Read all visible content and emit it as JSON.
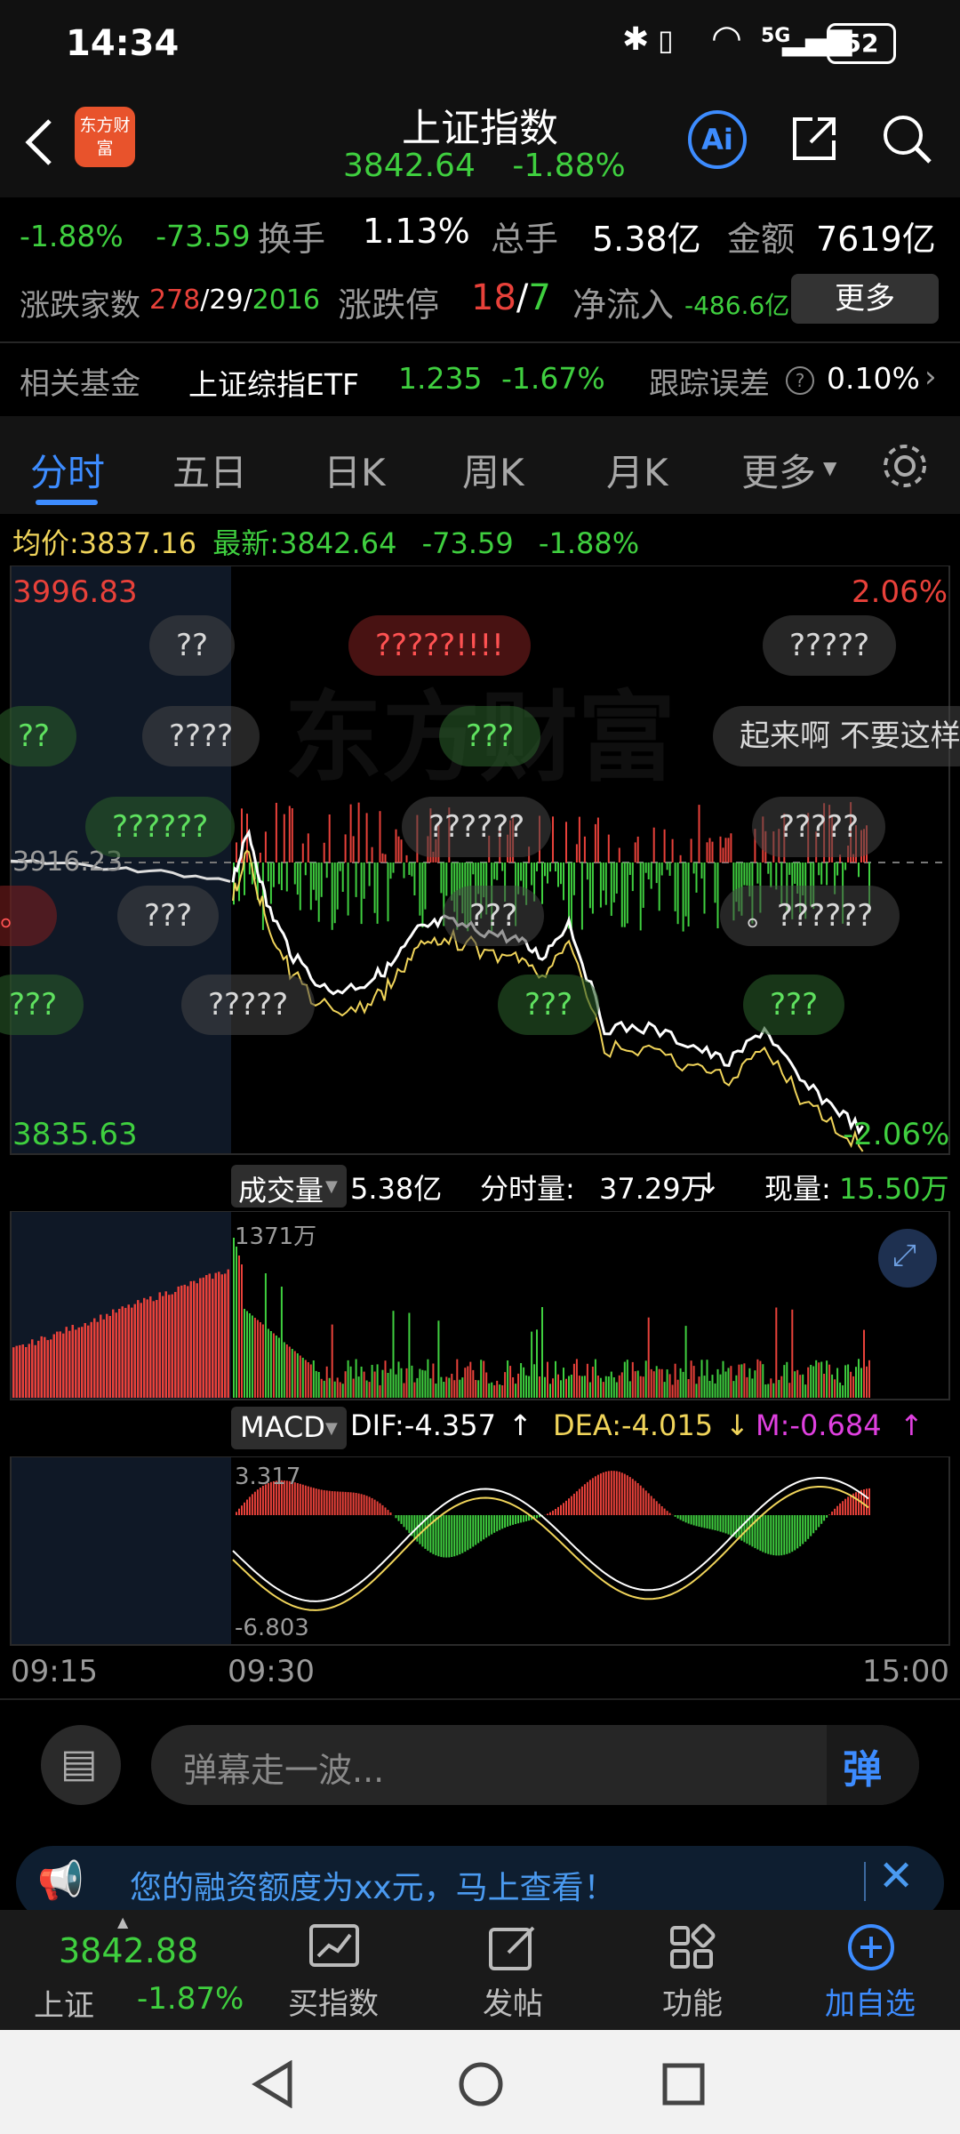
{
  "status": {
    "time": "14:34",
    "battery": "52",
    "network": "5G"
  },
  "header": {
    "title": "上证指数",
    "price": "3842.64",
    "change_pct": "-1.88%",
    "ai_label": "Ai",
    "logo_text": "东方财富"
  },
  "info_row1": {
    "change_pct": "-1.88%",
    "change": "-73.59",
    "turnover_label": "换手",
    "turnover": "1.13%",
    "volume_label": "总手",
    "volume": "5.38亿",
    "amount_label": "金额",
    "amount": "7619亿"
  },
  "info_row2": {
    "breadth_label": "涨跌家数",
    "up": "278",
    "flat": "29",
    "down": "2016",
    "limit_label": "涨跌停",
    "limit_up": "18",
    "limit_down": "7",
    "netflow_label": "净流入",
    "netflow": "-486.6亿",
    "more": "更多"
  },
  "fund_row": {
    "label": "相关基金",
    "name": "上证综指ETF",
    "price": "1.235",
    "change": "-1.67%",
    "tracking_label": "跟踪误差",
    "tracking": "0.10%"
  },
  "tabs": [
    "分时",
    "五日",
    "日K",
    "周K",
    "月K",
    "更多"
  ],
  "price_info": {
    "avg_label": "均价:",
    "avg": "3837.16",
    "last_label": "最新:",
    "last": "3842.64",
    "chg": "-73.59",
    "pct": "-1.88%"
  },
  "chart_labels": {
    "high": "3996.83",
    "high_pct": "2.06%",
    "low": "3835.63",
    "low_pct": "-2.06%",
    "prev_close": "3916.23",
    "watermark": "东方财富"
  },
  "danmaku": [
    {
      "text": "??",
      "type": "n"
    },
    {
      "text": "?????!!!!",
      "type": "r"
    },
    {
      "text": "?????",
      "type": "n"
    },
    {
      "text": "??",
      "type": "g"
    },
    {
      "text": "????",
      "type": "n"
    },
    {
      "text": "???",
      "type": "g"
    },
    {
      "text": "起来啊 不要这样",
      "type": "n"
    },
    {
      "text": "??????",
      "type": "g"
    },
    {
      "text": "??????",
      "type": "n"
    },
    {
      "text": "?????",
      "type": "n"
    },
    {
      "text": "。",
      "type": "r"
    },
    {
      "text": "???",
      "type": "n"
    },
    {
      "text": "???",
      "type": "n"
    },
    {
      "text": "。??????",
      "type": "n"
    },
    {
      "text": "???",
      "type": "g"
    },
    {
      "text": "?????",
      "type": "n"
    },
    {
      "text": "???",
      "type": "g"
    },
    {
      "text": "???",
      "type": "g"
    }
  ],
  "volume_info": {
    "label": "成交量",
    "total": "5.38亿",
    "minute_label": "分时量:",
    "minute": "37.29万",
    "current_label": "现量:",
    "current": "15.50万",
    "max": "1371万"
  },
  "macd_info": {
    "label": "MACD",
    "dif": "DIF:-4.357",
    "dea": "DEA:-4.015",
    "m": "M:-0.684",
    "max": "3.317",
    "min": "-6.803"
  },
  "time_axis": [
    "09:15",
    "09:30",
    "15:00"
  ],
  "comment": {
    "placeholder": "弹幕走一波...",
    "send": "弹"
  },
  "banner": {
    "text": "您的融资额度为xx元，马上查看！"
  },
  "bottom_nav": {
    "index_price": "3842.88",
    "index_name": "上证",
    "index_pct": "-1.87%",
    "items": [
      "买指数",
      "发帖",
      "功能",
      "加自选"
    ]
  },
  "colors": {
    "up": "#e8413a",
    "down": "#3fcf3f",
    "accent": "#3d8cff",
    "avg_line": "#f0d45a"
  }
}
